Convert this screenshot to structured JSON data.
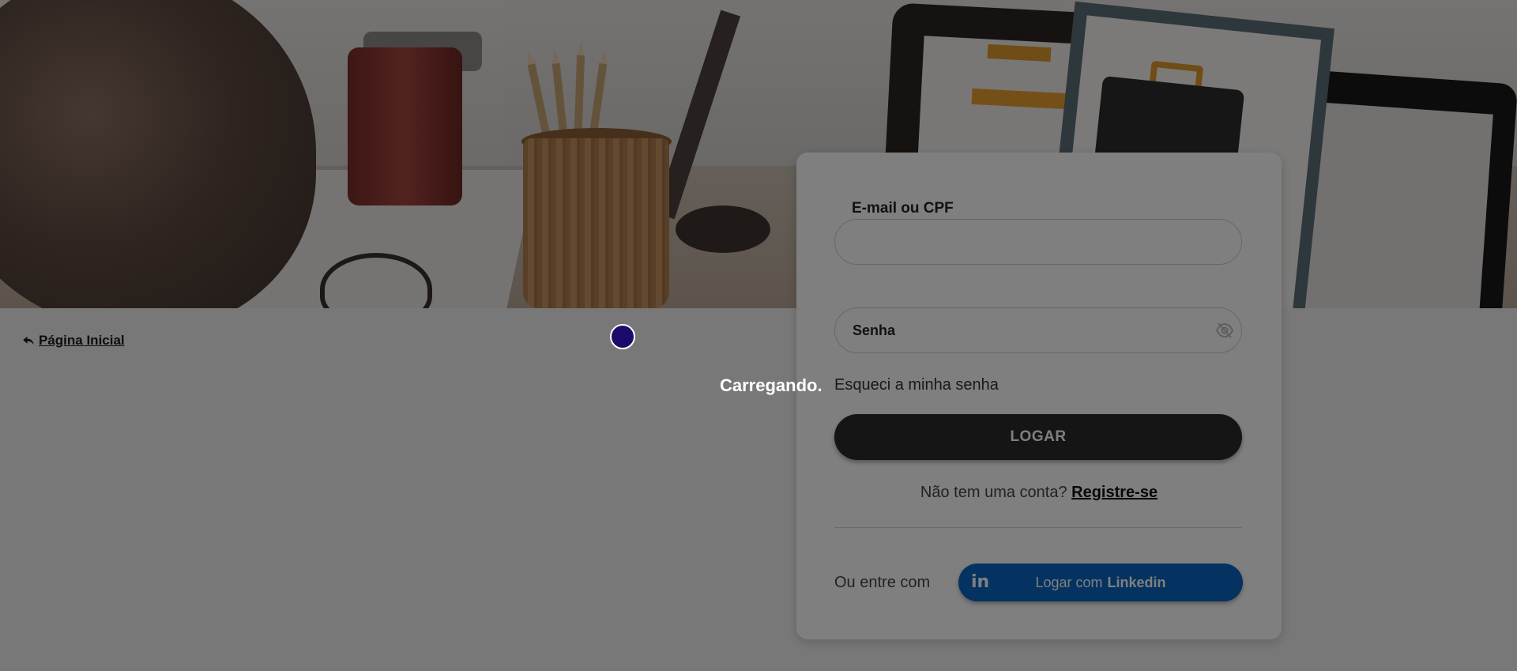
{
  "home_link": {
    "label": "Página Inicial",
    "icon": "reply-arrow-icon"
  },
  "login_form": {
    "email_label": "E-mail ou CPF",
    "email_value": "",
    "password_placeholder": "Senha",
    "password_toggle_icon": "eye-slash-icon",
    "forgot_password": "Esqueci a minha senha",
    "login_button": "LOGAR",
    "no_account_text": "Não tem uma conta?",
    "register_link": "Registre-se",
    "or_text": "Ou entre com",
    "linkedin_prefix": "Logar com",
    "linkedin_brand": "Linkedin",
    "linkedin_icon_text": "in"
  },
  "loading": {
    "text": "Carregando."
  },
  "colors": {
    "login_button": "#2a2a2a",
    "linkedin_button": "#0a66c2",
    "spinner": "#1d0a6b",
    "overlay": "rgba(0,0,0,0.5)"
  }
}
